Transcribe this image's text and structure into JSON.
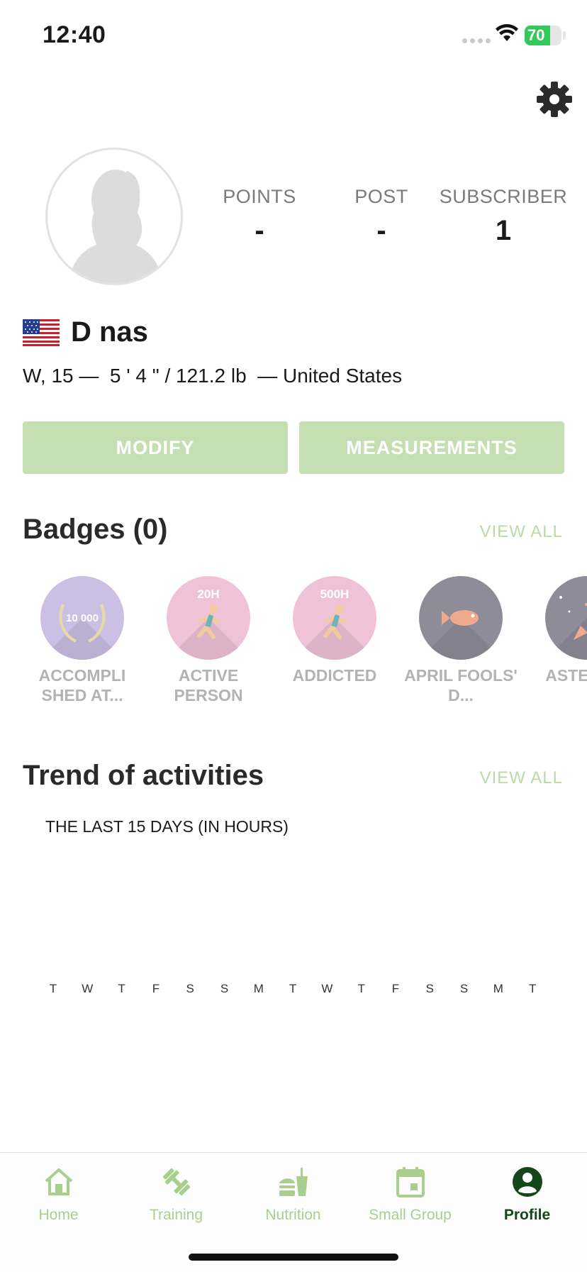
{
  "status": {
    "time": "12:40",
    "battery": "70"
  },
  "profile": {
    "stats": [
      {
        "label": "POINTS",
        "value": "-"
      },
      {
        "label": "POST",
        "value": "-"
      },
      {
        "label": "SUBSCRIBER",
        "value": "1"
      }
    ],
    "name": "D nas",
    "details": "W, 15 —  5 ' 4 \" / 121.2 lb  — United States"
  },
  "actions": {
    "modify": "MODIFY",
    "measurements": "MEASUREMENTS"
  },
  "badges": {
    "title": "Badges (0)",
    "view_all": "VIEW ALL",
    "items": [
      {
        "label": "ACCOMPLI SHED AT...",
        "icon_text": "10 000",
        "color": "#cbbfe3",
        "icon": "laurel-icon"
      },
      {
        "label": "ACTIVE PERSON",
        "icon_text": "20H",
        "color": "#efc2d8",
        "icon": "runner-icon"
      },
      {
        "label": "ADDICTED",
        "icon_text": "500H",
        "color": "#efc2d8",
        "icon": "runner-icon"
      },
      {
        "label": "APRIL FOOLS' D...",
        "icon_text": "",
        "color": "#8f8c99",
        "icon": "fish-icon"
      },
      {
        "label": "ASTER DA",
        "icon_text": "",
        "color": "#8f8c99",
        "icon": "rocket-icon"
      }
    ]
  },
  "trend": {
    "title": "Trend of activities",
    "view_all": "VIEW ALL",
    "subtitle": "THE LAST 15 DAYS (IN HOURS)"
  },
  "chart_data": {
    "type": "bar",
    "categories": [
      "T",
      "W",
      "T",
      "F",
      "S",
      "S",
      "M",
      "T",
      "W",
      "T",
      "F",
      "S",
      "S",
      "M",
      "T"
    ],
    "values": [
      0,
      0,
      0,
      0,
      0,
      0,
      0,
      0,
      0,
      0,
      0,
      0,
      0,
      0,
      0
    ]
  },
  "tabs": [
    {
      "label": "Home",
      "icon": "home-icon"
    },
    {
      "label": "Training",
      "icon": "dumbbell-icon"
    },
    {
      "label": "Nutrition",
      "icon": "food-icon"
    },
    {
      "label": "Small Group",
      "icon": "calendar-icon"
    },
    {
      "label": "Profile",
      "icon": "profile-icon",
      "active": true
    }
  ],
  "colors": {
    "accent": "#c5dfb3",
    "tab_inactive": "#a9cf8f",
    "tab_active": "#14461a"
  }
}
